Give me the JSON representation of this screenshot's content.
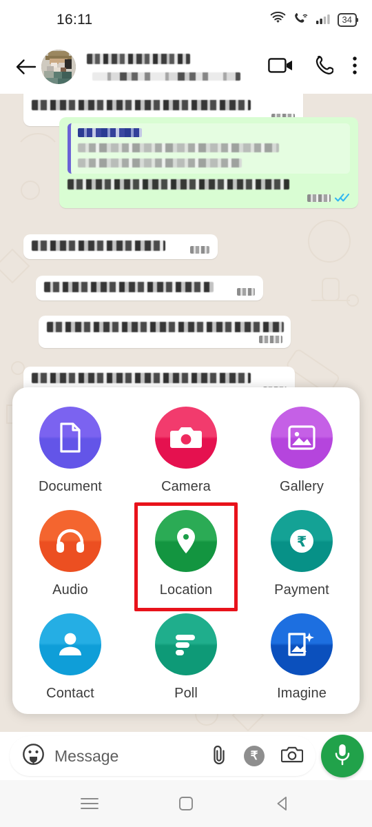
{
  "status_bar": {
    "time": "16:11",
    "battery_level": "34",
    "icons": [
      "wifi-icon",
      "wifi-calling-icon",
      "signal-bars-icon",
      "battery-icon"
    ]
  },
  "app_bar": {
    "back_icon": "arrow-left-icon",
    "avatar": "contact-avatar",
    "contact_name_redacted": true,
    "contact_status_redacted": true,
    "video_call_icon": "video-camera-icon",
    "voice_call_icon": "phone-icon",
    "overflow_icon": "more-vertical-icon"
  },
  "chat": {
    "background": "whatsapp-doodle-pattern",
    "bubble_in_color": "#ffffff",
    "bubble_out_color": "#d9fdd3",
    "quote_accent_color": "#6b63d6",
    "read_ticks_color": "#34b7f1",
    "messages": [
      {
        "side": "in",
        "redacted": true,
        "lines": 1
      },
      {
        "side": "out",
        "redacted": true,
        "has_quote": true,
        "lines": 1,
        "ticks": "read"
      },
      {
        "side": "in",
        "redacted": true,
        "lines": 1
      },
      {
        "side": "in",
        "redacted": true,
        "lines": 1
      },
      {
        "side": "in",
        "redacted": true,
        "lines": 1
      },
      {
        "side": "in",
        "redacted": true,
        "lines": 1
      }
    ]
  },
  "attachment_sheet": {
    "highlighted_item": "Location",
    "highlight_color": "#e8121b",
    "items": [
      {
        "label": "Document",
        "icon": "document-icon",
        "color_from": "#7b63f0",
        "color_to": "#6355e8"
      },
      {
        "label": "Camera",
        "icon": "camera-icon",
        "color_from": "#f23b6d",
        "color_to": "#e5114f"
      },
      {
        "label": "Gallery",
        "icon": "gallery-icon",
        "color_from": "#c560e6",
        "color_to": "#b545dd"
      },
      {
        "label": "Audio",
        "icon": "headphones-icon",
        "color_from": "#f4652f",
        "color_to": "#ec4f21"
      },
      {
        "label": "Location",
        "icon": "map-pin-icon",
        "color_from": "#2bab55",
        "color_to": "#139540"
      },
      {
        "label": "Payment",
        "icon": "rupee-coin-icon",
        "color_from": "#14a295",
        "color_to": "#079187"
      },
      {
        "label": "Contact",
        "icon": "person-icon",
        "color_from": "#25aee4",
        "color_to": "#0f9ed8"
      },
      {
        "label": "Poll",
        "icon": "poll-bars-icon",
        "color_from": "#1fae8c",
        "color_to": "#0e9a77"
      },
      {
        "label": "Imagine",
        "icon": "image-sparkle-icon",
        "color_from": "#1d6fe0",
        "color_to": "#0b50bd"
      }
    ]
  },
  "composer": {
    "placeholder": "Message",
    "sticker_icon": "sticker-emoji-icon",
    "attach_icon": "paperclip-icon",
    "payment_icon": "rupee-circle-icon",
    "camera_icon": "camera-icon",
    "mic_icon": "microphone-icon",
    "mic_button_color": "#21a24a"
  },
  "nav_bar": {
    "recents_icon": "hamburger-recents-icon",
    "home_icon": "square-home-icon",
    "back_icon": "triangle-back-icon"
  }
}
